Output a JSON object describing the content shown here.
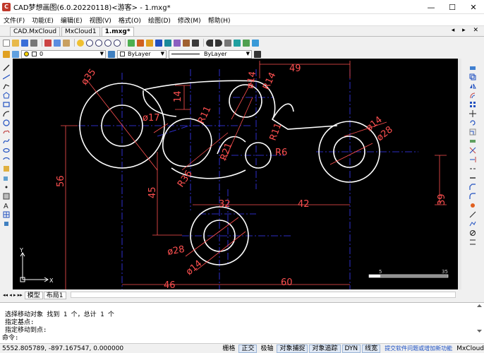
{
  "window": {
    "title": "CAD梦想画图(6.0.20220118)<游客> - 1.mxg*",
    "minimize_glyph": "—",
    "maximize_glyph": "☐",
    "close_glyph": "✕"
  },
  "menu": [
    "文件(F)",
    "功能(E)",
    "编辑(E)",
    "视图(V)",
    "格式(O)",
    "绘图(D)",
    "修改(M)",
    "帮助(H)"
  ],
  "doc_tabs": [
    "CAD.MxCloud",
    "MxCloud1",
    "1.mxg*"
  ],
  "tab_controls": "◂ ▸ ✕",
  "layer_toolbar": {
    "layer_value": "0",
    "color_value": "ByLayer",
    "linetype_value": "ByLayer"
  },
  "drawing": {
    "dimensions": [
      "49",
      "ø35",
      "ø17",
      "ø14",
      "R14",
      "14",
      "R11",
      "R11",
      "R21",
      "R6",
      "ø14",
      "ø28",
      "56",
      "R36",
      "45",
      "32",
      "42",
      "39",
      "ø28",
      "ø14",
      "46",
      "60"
    ],
    "scale_labels": [
      "5",
      "35"
    ]
  },
  "ucs": {
    "x_label": "X",
    "y_label": "Y"
  },
  "layout_tabs": {
    "nav": "◂◂ ◂ ▸ ▸▸",
    "model": "模型",
    "layout1": "布局1"
  },
  "command": {
    "history": [
      "选择移动对象  找到 1 个，总计 1 个",
      "指定基点:",
      "指定移动到点:"
    ],
    "prompt": "命令:"
  },
  "status": {
    "coords": "5552.805789,  -897.167547,  0.000000",
    "toggles": [
      {
        "label": "栅格",
        "on": false
      },
      {
        "label": "正交",
        "on": true
      },
      {
        "label": "极轴",
        "on": false
      },
      {
        "label": "对象捕捉",
        "on": true
      },
      {
        "label": "对象追踪",
        "on": true
      },
      {
        "label": "DYN",
        "on": true
      },
      {
        "label": "线宽",
        "on": true
      }
    ],
    "feedback": "提交软件问题或增加新功能",
    "brand": "MxCloud"
  },
  "colors": {
    "canvas": "#000000",
    "geometry": "#ffffff",
    "dimension": "#ff5050",
    "centerline": "#3a3aff"
  }
}
